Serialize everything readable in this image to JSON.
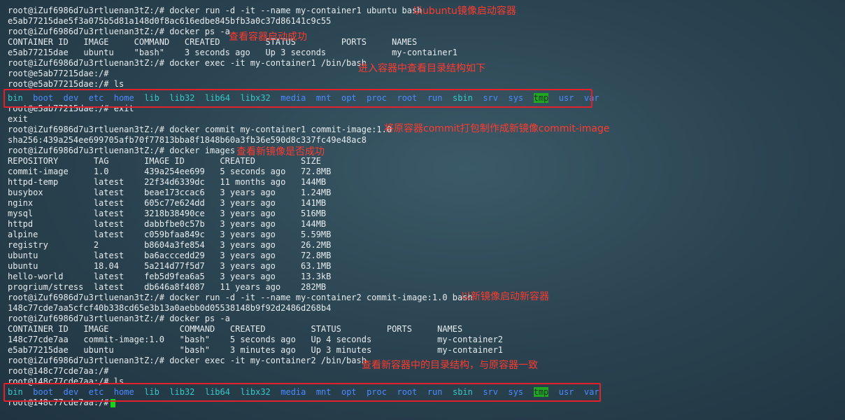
{
  "lines": [
    "root@iZuf6986d7u3rtluenan3tZ:/# docker run -d -it --name my-container1 ubuntu bash",
    "e5ab77215dae5f3a075b5d81a148d0f8ac616edbe845bfb3a0c37d86141c9c55",
    "root@iZuf6986d7u3rtluenan3tZ:/# docker ps -a",
    "CONTAINER ID   IMAGE     COMMAND   CREATED         STATUS         PORTS     NAMES",
    "e5ab77215dae   ubuntu    \"bash\"    3 seconds ago   Up 3 seconds             my-container1",
    "root@iZuf6986d7u3rtluenan3tZ:/# docker exec -it my-container1 /bin/bash",
    "root@e5ab77215dae:/#",
    "root@e5ab77215dae:/# ls",
    "",
    "root@e5ab77215dae:/# exit",
    "exit",
    "root@iZuf6986d7u3rtluenan3tZ:/# docker commit my-container1 commit-image:1.0",
    "sha256:439a254ee699705afb70f77813bba8f1848b60a3fb36e590d8c337fc49e48ac8",
    "root@iZuf6986d7u3rtluenan3tZ:/# docker images",
    "REPOSITORY       TAG       IMAGE ID       CREATED         SIZE",
    "commit-image     1.0       439a254ee699   5 seconds ago   72.8MB",
    "httpd-temp       latest    22f34d6339dc   11 months ago   144MB",
    "busybox          latest    beae173ccac6   3 years ago     1.24MB",
    "nginx            latest    605c77e624dd   3 years ago     141MB",
    "mysql            latest    3218b38490ce   3 years ago     516MB",
    "httpd            latest    dabbfbe0c57b   3 years ago     144MB",
    "alpine           latest    c059bfaa849c   3 years ago     5.59MB",
    "registry         2         b8604a3fe854   3 years ago     26.2MB",
    "ubuntu           latest    ba6acccedd29   3 years ago     72.8MB",
    "ubuntu           18.04     5a214d77f5d7   3 years ago     63.1MB",
    "hello-world      latest    feb5d9fea6a5   3 years ago     13.3kB",
    "progrium/stress  latest    db646a8f4087   11 years ago    282MB",
    "root@iZuf6986d7u3rtluenan3tZ:/# docker run -d -it --name my-container2 commit-image:1.0 bash",
    "148c77cde7aa5cfcf40b338cd65e3b13a0aebb0d05538148b9f92d2486d268b4",
    "root@iZuf6986d7u3rtluenan3tZ:/# docker ps -a",
    "CONTAINER ID   IMAGE              COMMAND   CREATED         STATUS         PORTS     NAMES",
    "148c77cde7aa   commit-image:1.0   \"bash\"    5 seconds ago   Up 4 seconds             my-container2",
    "e5ab77215dae   ubuntu             \"bash\"    3 minutes ago   Up 3 minutes             my-container1",
    "root@iZuf6986d7u3rtluenan3tZ:/# docker exec -it my-container2 /bin/bash",
    "root@148c77cde7aa:/#",
    "root@148c77cde7aa:/# ls",
    "",
    "root@148c77cde7aa:/# "
  ],
  "ls_output": [
    "bin",
    "boot",
    "dev",
    "etc",
    "home",
    "lib",
    "lib32",
    "lib64",
    "libx32",
    "media",
    "mnt",
    "opt",
    "proc",
    "root",
    "run",
    "sbin",
    "srv",
    "sys",
    "tmp",
    "usr",
    "var"
  ],
  "ls_colors": {
    "directory": "#4b8bff",
    "symlink": "#36c8c8",
    "sticky_dir_bg": "#1fa81f"
  },
  "annotations": [
    {
      "text": "以ubuntu镜像启动容器"
    },
    {
      "text": "查看容器启动成功"
    },
    {
      "text": "进入容器中查看目录结构如下"
    },
    {
      "text": "将原容器commit打包制作成新镜像commit-image"
    },
    {
      "text": "查看新镜像是否成功"
    },
    {
      "text": "以新镜像启动新容器"
    },
    {
      "text": "查看新容器中的目录结构，与原容器一致"
    }
  ]
}
